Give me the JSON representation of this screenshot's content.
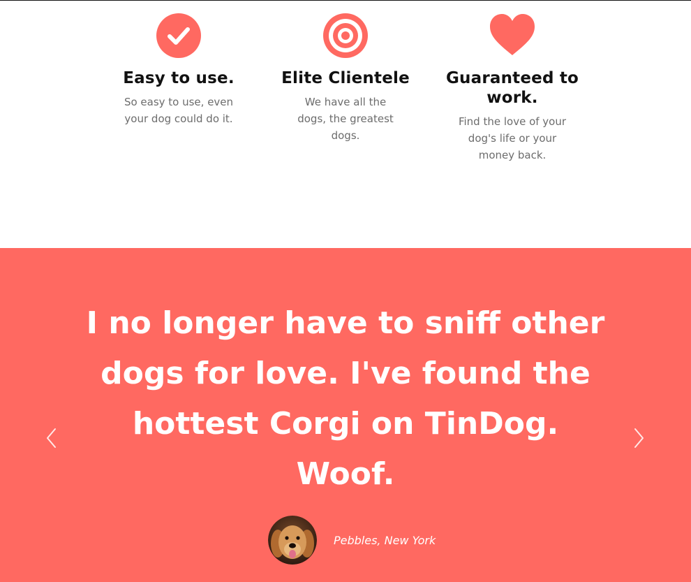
{
  "features": [
    {
      "icon": "check-circle-icon",
      "title": "Easy to use.",
      "description": "So easy to use, even your dog could do it."
    },
    {
      "icon": "bullseye-icon",
      "title": "Elite Clientele",
      "description": "We have all the dogs, the greatest dogs."
    },
    {
      "icon": "heart-icon",
      "title": "Guaranteed to work.",
      "description": "Find the love of your dog's life or your money back."
    }
  ],
  "testimonial": {
    "quote": "I no longer have to sniff other dogs for love. I've found the hottest Corgi on TinDog. Woof.",
    "author": "Pebbles, New York",
    "avatar_icon": "dog-avatar",
    "prev_icon": "chevron-left-icon",
    "next_icon": "chevron-right-icon"
  },
  "colors": {
    "accent": "#ff6961",
    "heading": "#111111",
    "body_text": "#6c6c6c",
    "background": "#ffffff"
  }
}
